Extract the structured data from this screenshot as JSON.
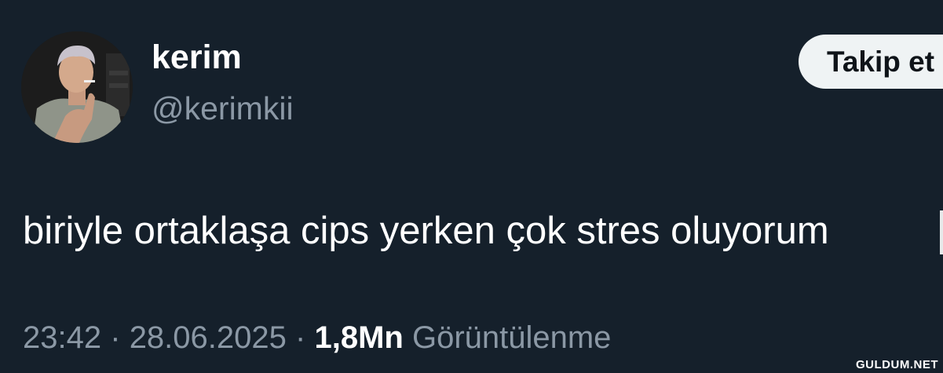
{
  "tweet": {
    "display_name": "kerim",
    "handle": "@kerimkii",
    "follow_label": "Takip et",
    "text": "biriyle ortaklaşa cips yerken çok stres oluyorum",
    "time": "23:42",
    "date": "28.06.2025",
    "separator": "·",
    "views_count": "1,8Mn",
    "views_label": "Görüntülenme"
  },
  "watermark": "GULDUM.NET",
  "colors": {
    "background": "#15202b",
    "secondary_text": "#8b98a5",
    "primary_text": "#ffffff",
    "button_bg": "#eff3f4",
    "button_text": "#0f1419"
  }
}
